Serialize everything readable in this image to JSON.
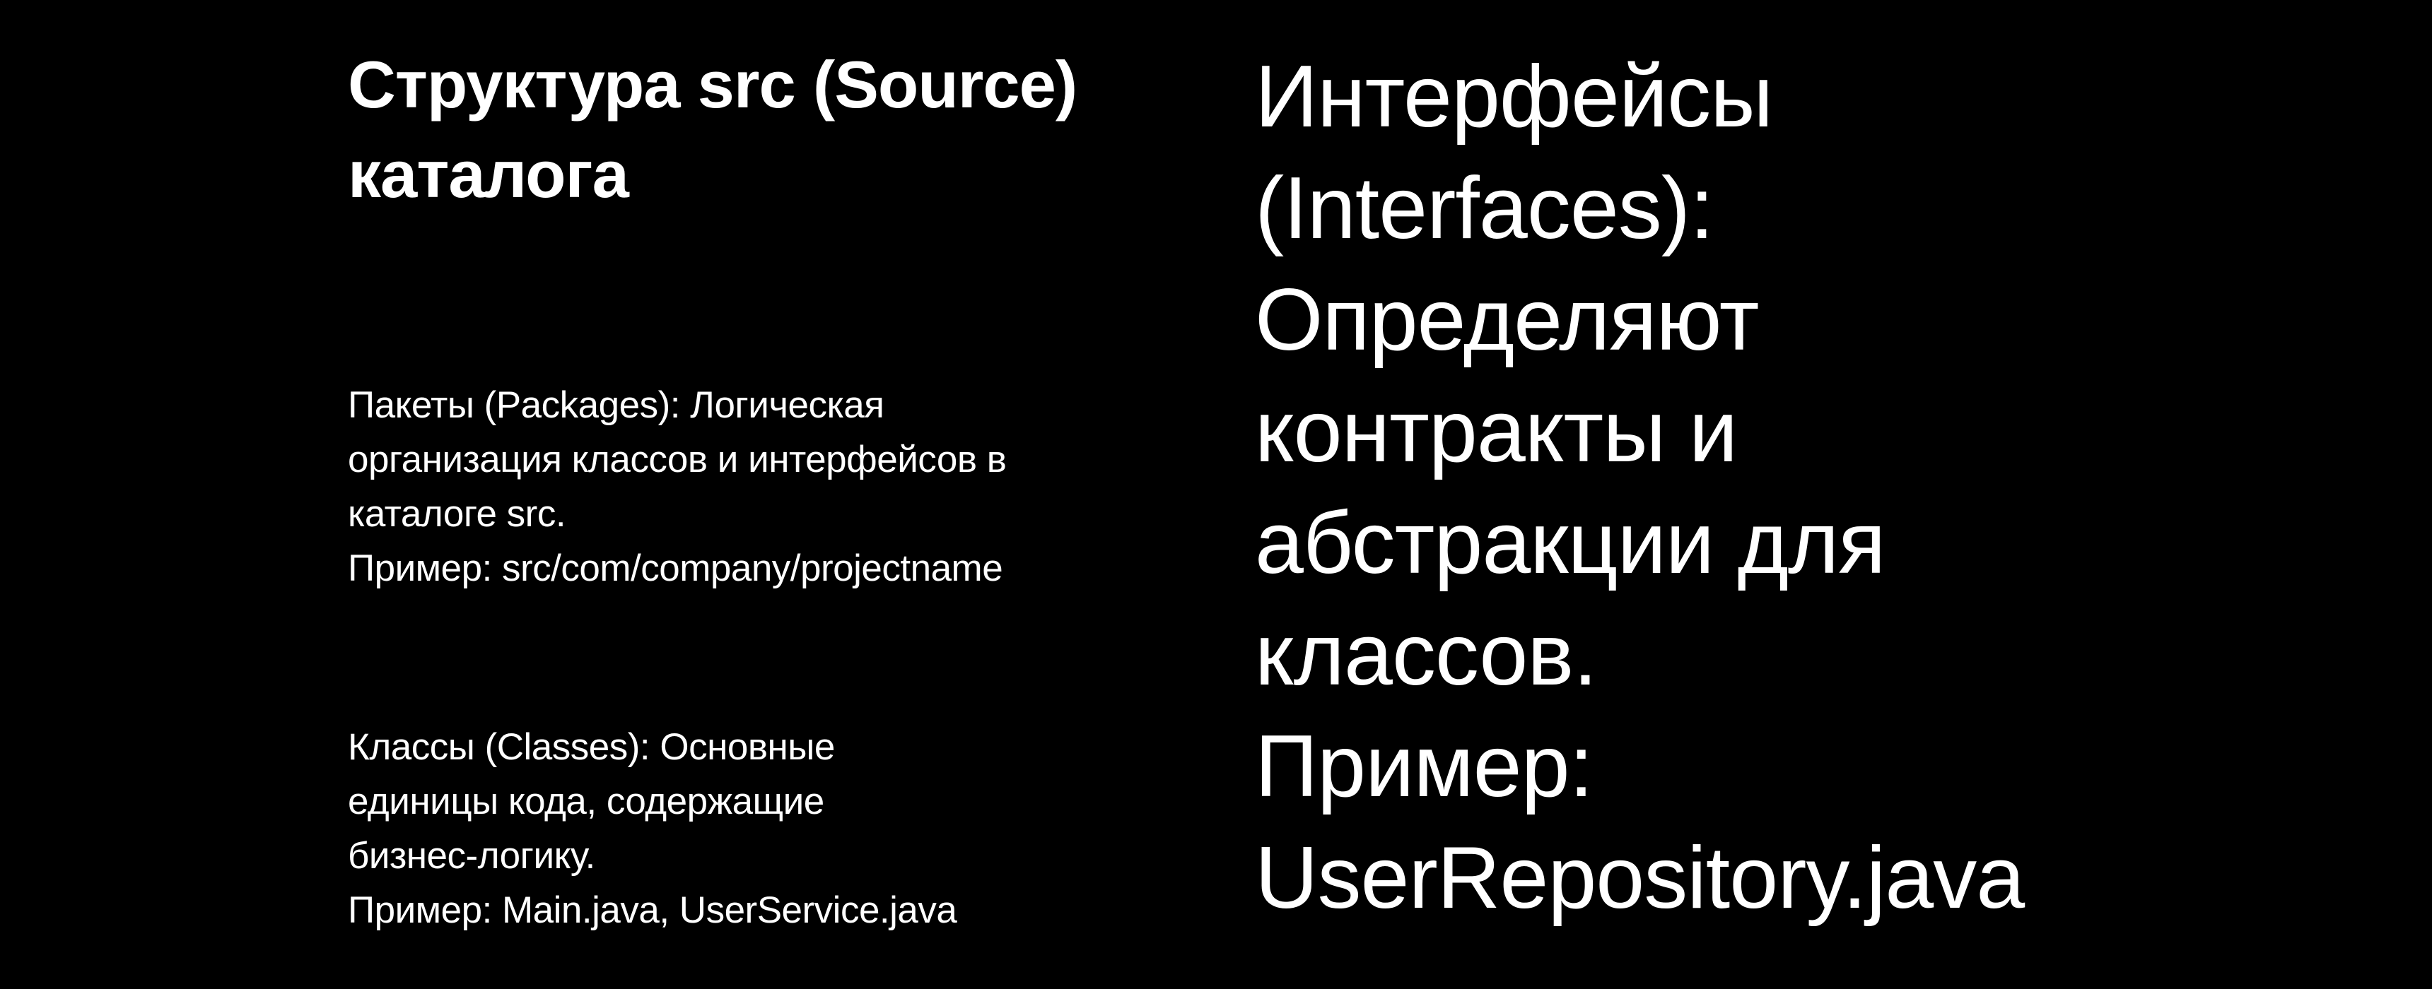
{
  "title": {
    "lines": [
      "Структура src (Source)",
      "каталога"
    ]
  },
  "packages": {
    "lines": [
      "Пакеты (Packages): Логическая",
      "организация классов и интерфейсов в",
      "каталоге src.",
      "Пример: src/com/company/projectname"
    ]
  },
  "classes": {
    "lines": [
      "Классы (Classes): Основные",
      "единицы кода, содержащие",
      "бизнес-логику.",
      "Пример: Main.java, UserService.java"
    ]
  },
  "interfaces": {
    "lines": [
      "Интерфейсы",
      "(Interfaces):",
      "Определяют",
      "контракты и",
      "абстракции для",
      "классов.",
      "Пример:",
      "UserRepository.java"
    ]
  },
  "colors": {
    "background": "#000000",
    "text": "#ffffff"
  }
}
